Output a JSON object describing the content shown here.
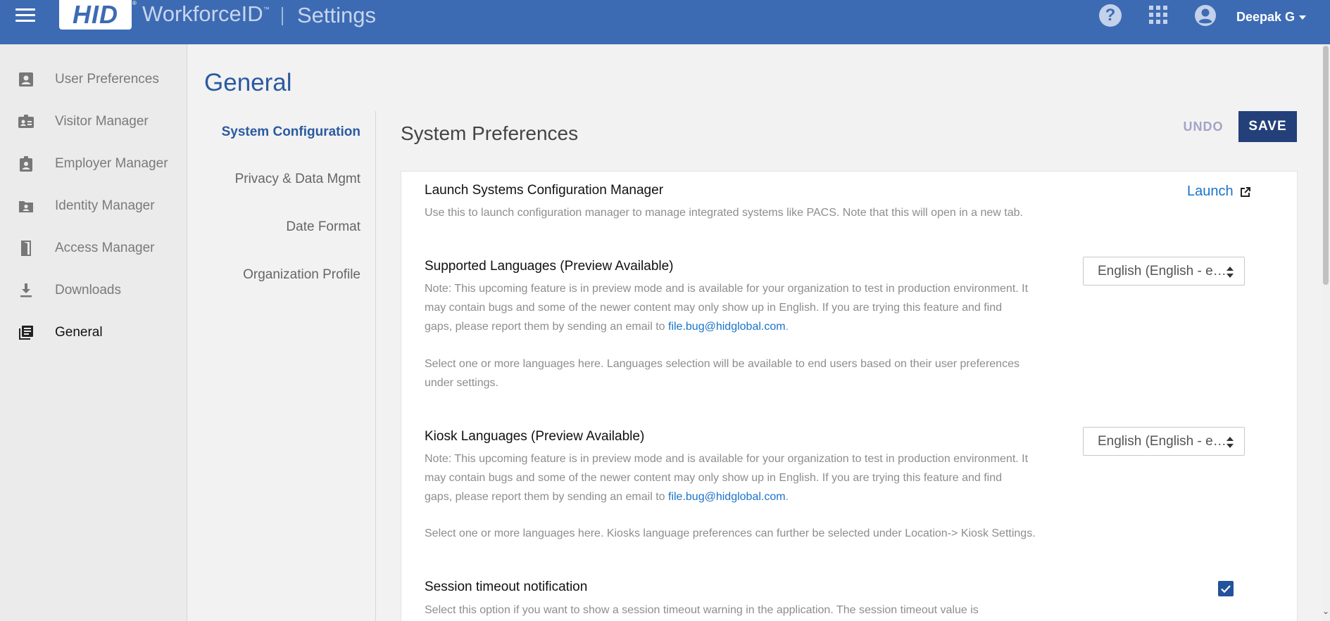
{
  "header": {
    "logo_text": "HID",
    "reg_mark": "®",
    "product": "WorkforceID",
    "product_tm": "™",
    "section": "Settings",
    "user_name": "Deepak G",
    "icons": {
      "menu": "hamburger-icon",
      "help": "help-icon",
      "apps": "apps-grid-icon",
      "account": "account-circle-icon"
    },
    "brand_color": "#3d6bb3"
  },
  "sidebar": {
    "items": [
      {
        "label": "User Preferences",
        "icon": "user-badge-icon",
        "active": false
      },
      {
        "label": "Visitor Manager",
        "icon": "visitor-card-icon",
        "active": false
      },
      {
        "label": "Employer Manager",
        "icon": "employee-badge-icon",
        "active": false
      },
      {
        "label": "Identity Manager",
        "icon": "identity-folder-icon",
        "active": false
      },
      {
        "label": "Access Manager",
        "icon": "door-icon",
        "active": false
      },
      {
        "label": "Downloads",
        "icon": "download-icon",
        "active": false
      },
      {
        "label": "General",
        "icon": "library-books-icon",
        "active": true
      }
    ]
  },
  "page": {
    "title": "General",
    "subnav": [
      {
        "label": "System Configuration",
        "active": true
      },
      {
        "label": "Privacy & Data Mgmt",
        "active": false
      },
      {
        "label": "Date Format",
        "active": false
      },
      {
        "label": "Organization Profile",
        "active": false
      }
    ],
    "panel_heading": "System Preferences",
    "undo_label": "UNDO",
    "save_label": "SAVE"
  },
  "settings": {
    "launch": {
      "title": "Launch Systems Configuration Manager",
      "desc": "Use this to launch configuration manager to manage integrated systems like PACS. Note that this will open in a new tab.",
      "link_label": "Launch"
    },
    "supported_languages": {
      "title": "Supported Languages (Preview Available)",
      "note_line1": "Note: This upcoming feature is in preview mode and is available for your organization to test in production environment. It",
      "note_line2": "may contain bugs and some of the newer content may only show up in English. If you are trying this feature and find",
      "note_line3": "gaps, please report them by sending an email to",
      "email": "file.bug@hidglobal.com",
      "period": ".",
      "select_line1": "Select one or more languages here. Languages selection will be available to end users based on their user preferences",
      "select_line2": "under settings.",
      "selected_value": "English (English - e…"
    },
    "kiosk_languages": {
      "title": "Kiosk Languages (Preview Available)",
      "note_line1": "Note: This upcoming feature is in preview mode and is available for your organization to test in production environment. It",
      "note_line2": "may contain bugs and some of the newer content may only show up in English. If you are trying this feature and find",
      "note_line3": "gaps, please report them by sending an email to",
      "email": "file.bug@hidglobal.com",
      "period": ".",
      "select_line1": "Select one or more languages here. Kiosks language preferences can further be selected under Location-> Kiosk Settings.",
      "selected_value": "English (English - e…"
    },
    "session_timeout": {
      "title": "Session timeout notification",
      "desc": "Select this option if you want to show a session timeout warning in the application. The session timeout value is",
      "checked": true
    }
  }
}
